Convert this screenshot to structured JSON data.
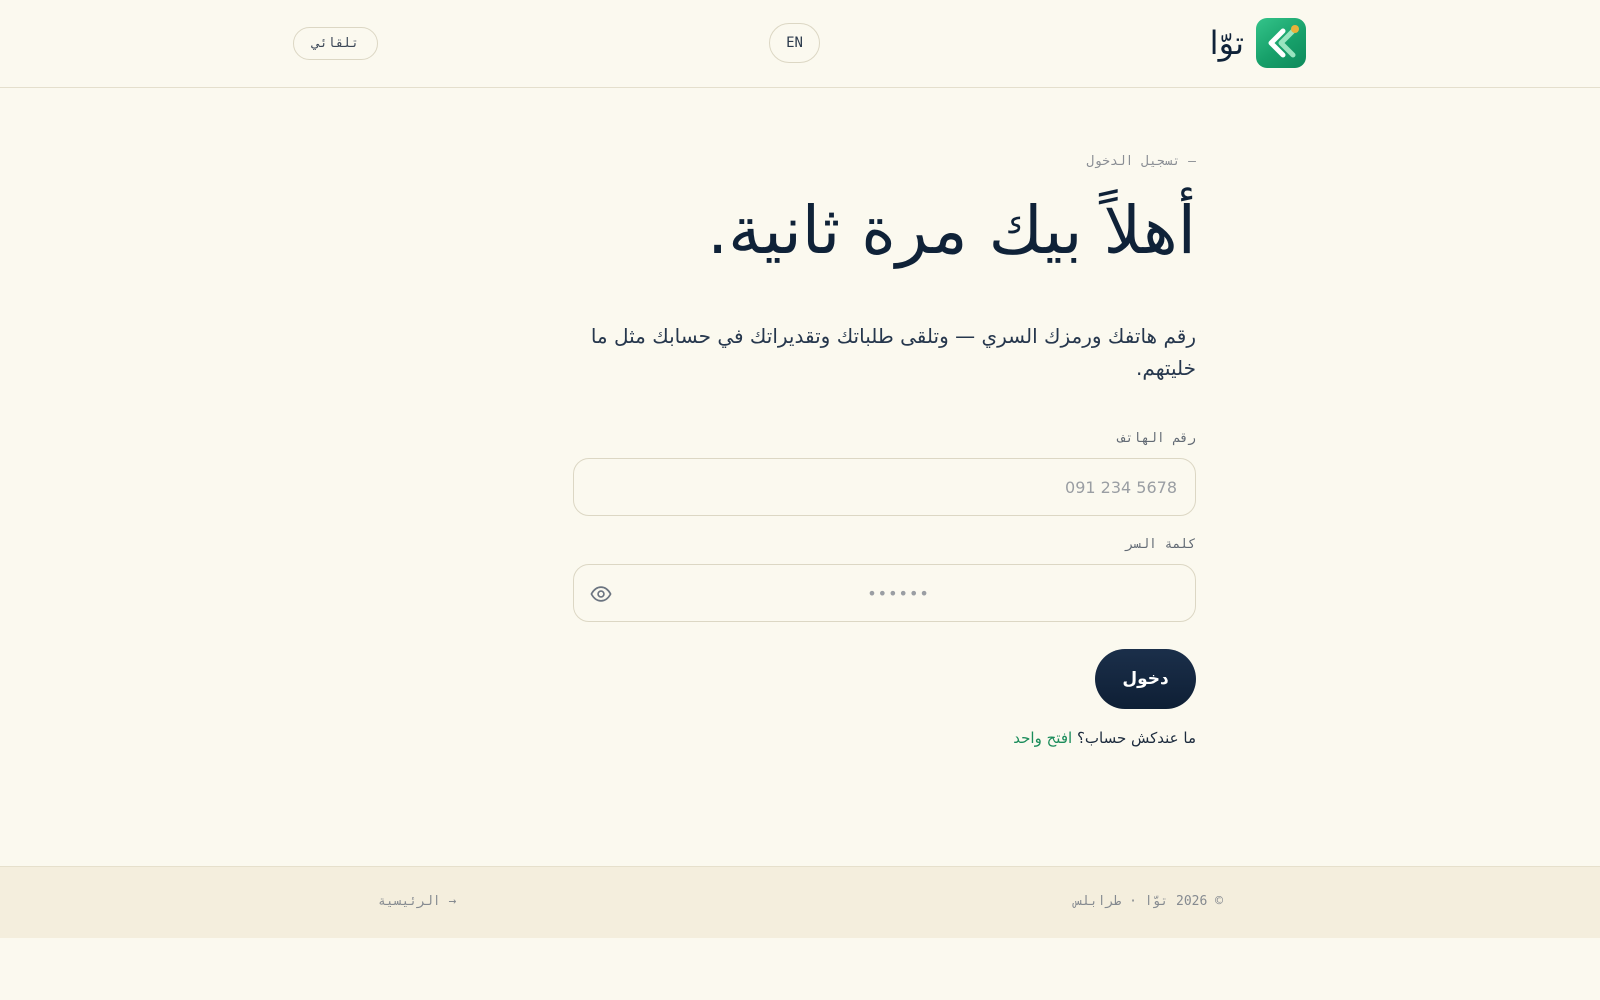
{
  "header": {
    "brand_name": "توّا",
    "logo_icon": "chevron-left-double-icon",
    "lang_label": "EN",
    "theme_label": "تلقائي"
  },
  "main": {
    "eyebrow": "— تسجيل الدخول",
    "title": "أهلاً بيك مرة ثانية.",
    "subtitle": "رقم هاتفك ورمزك السري — وتلقى طلباتك وتقديراتك في حسابك مثل ما خليتهم.",
    "phone": {
      "label": "رقم الهاتف",
      "placeholder": "091 234 5678",
      "value": ""
    },
    "password": {
      "label": "كلمة السر",
      "placeholder": "••••••",
      "value": "",
      "toggle_icon": "eye-icon"
    },
    "submit_label": "دخول",
    "signup_prompt": "ما عندكش حساب؟",
    "signup_link": "افتح واحد"
  },
  "footer": {
    "copyright": "© 2026 توّا · طرابلس",
    "home_link": "→ الرئيسية"
  },
  "colors": {
    "background": "#fbf9ef",
    "footer_background": "#f4eedd",
    "primary_navy": "#0f2238",
    "accent_green": "#1a8c5a",
    "logo_green": "#17a06a",
    "logo_dot": "#e8b23a"
  }
}
